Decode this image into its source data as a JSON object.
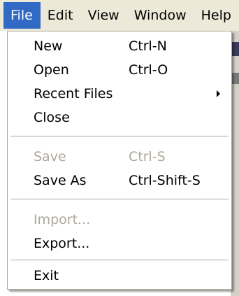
{
  "menubar": {
    "items": [
      {
        "label": "File",
        "active": true
      },
      {
        "label": "Edit"
      },
      {
        "label": "View"
      },
      {
        "label": "Window"
      },
      {
        "label": "Help"
      }
    ]
  },
  "file_menu": {
    "items": [
      {
        "label": "New",
        "shortcut": "Ctrl-N",
        "enabled": true
      },
      {
        "label": "Open",
        "shortcut": "Ctrl-O",
        "enabled": true
      },
      {
        "label": "Recent Files",
        "submenu": true,
        "enabled": true
      },
      {
        "label": "Close",
        "enabled": true
      },
      {
        "label": "Save",
        "shortcut": "Ctrl-S",
        "enabled": false
      },
      {
        "label": "Save As",
        "shortcut": "Ctrl-Shift-S",
        "enabled": true
      },
      {
        "label": "Import...",
        "enabled": false
      },
      {
        "label": "Export...",
        "enabled": true
      },
      {
        "label": "Exit",
        "enabled": true
      }
    ]
  },
  "colors": {
    "menubar_bg": "#ece9d8",
    "highlight": "#316ac5",
    "disabled_text": "#aca899"
  }
}
